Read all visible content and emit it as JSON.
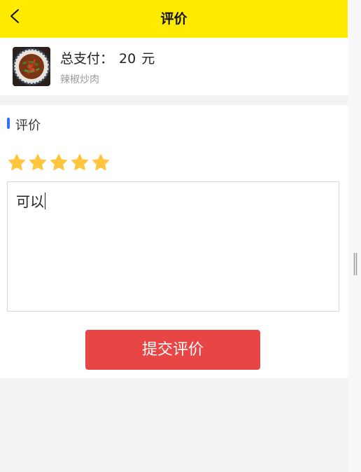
{
  "header": {
    "title": "评价"
  },
  "order": {
    "total_label": "总支付：",
    "total_amount": "20",
    "currency_unit": "元",
    "dish_name": "辣椒炒肉"
  },
  "review": {
    "section_title": "评价",
    "rating": 5,
    "max_rating": 5,
    "text": "可以",
    "submit_label": "提交评价"
  },
  "colors": {
    "header_bg": "#ffeb00",
    "accent_blue": "#2f73f6",
    "star": "#ffc53d",
    "submit_bg": "#e84545"
  },
  "icons": {
    "back": "chevron-left-icon",
    "star": "star-icon",
    "scroll": "scroll-handle-icon"
  }
}
